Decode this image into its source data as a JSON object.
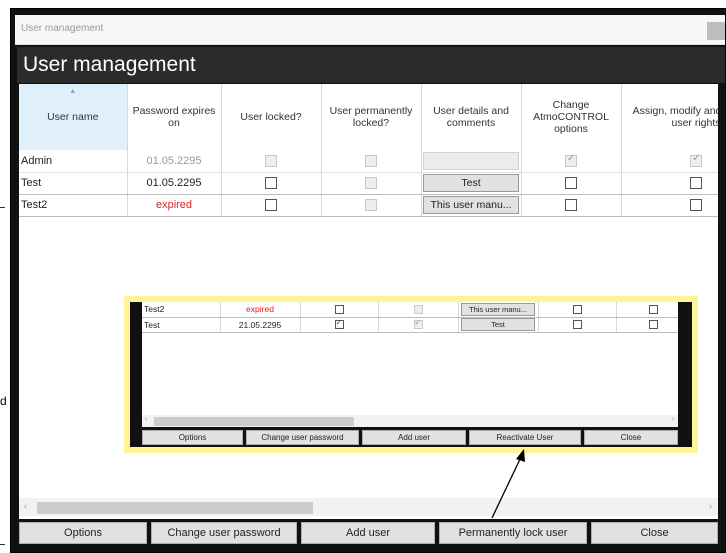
{
  "window": {
    "title": "User management"
  },
  "header": {
    "title": "User management"
  },
  "grid": {
    "columns": [
      "User name",
      "Password expires on",
      "User locked?",
      "User permanently locked?",
      "User details and comments",
      "Change AtmoCONTROL options",
      "Assign, modify and remove user rights"
    ],
    "rows": [
      {
        "name": "Admin",
        "expires": "01.05.2295",
        "locked": false,
        "perm_locked": false,
        "details": "",
        "change_options": true,
        "rights": true
      },
      {
        "name": "Test",
        "expires": "01.05.2295",
        "locked": false,
        "perm_locked": false,
        "details": "Test",
        "change_options": false,
        "rights": false
      },
      {
        "name": "Test2",
        "expires": "expired",
        "locked": false,
        "perm_locked": false,
        "details": "This user manu...",
        "change_options": false,
        "rights": false
      }
    ]
  },
  "buttons": {
    "options": "Options",
    "change_password": "Change user password",
    "add_user": "Add user",
    "perm_lock": "Permanently lock user",
    "close": "Close"
  },
  "inset": {
    "rows": [
      {
        "name": "Test2",
        "expires": "expired",
        "locked": false,
        "perm_locked": false,
        "details": "This user manu...",
        "change_options": false,
        "rights": false
      },
      {
        "name": "Test",
        "expires": "21.05.2295",
        "locked": true,
        "perm_locked": true,
        "details": "Test",
        "change_options": false,
        "rights": false
      }
    ],
    "buttons": {
      "options": "Options",
      "change_password": "Change user password",
      "add_user": "Add user",
      "reactivate": "Reactivate User",
      "close": "Close"
    },
    "highlight_color": "#fff594"
  },
  "page_side": {
    "letter": "d"
  }
}
